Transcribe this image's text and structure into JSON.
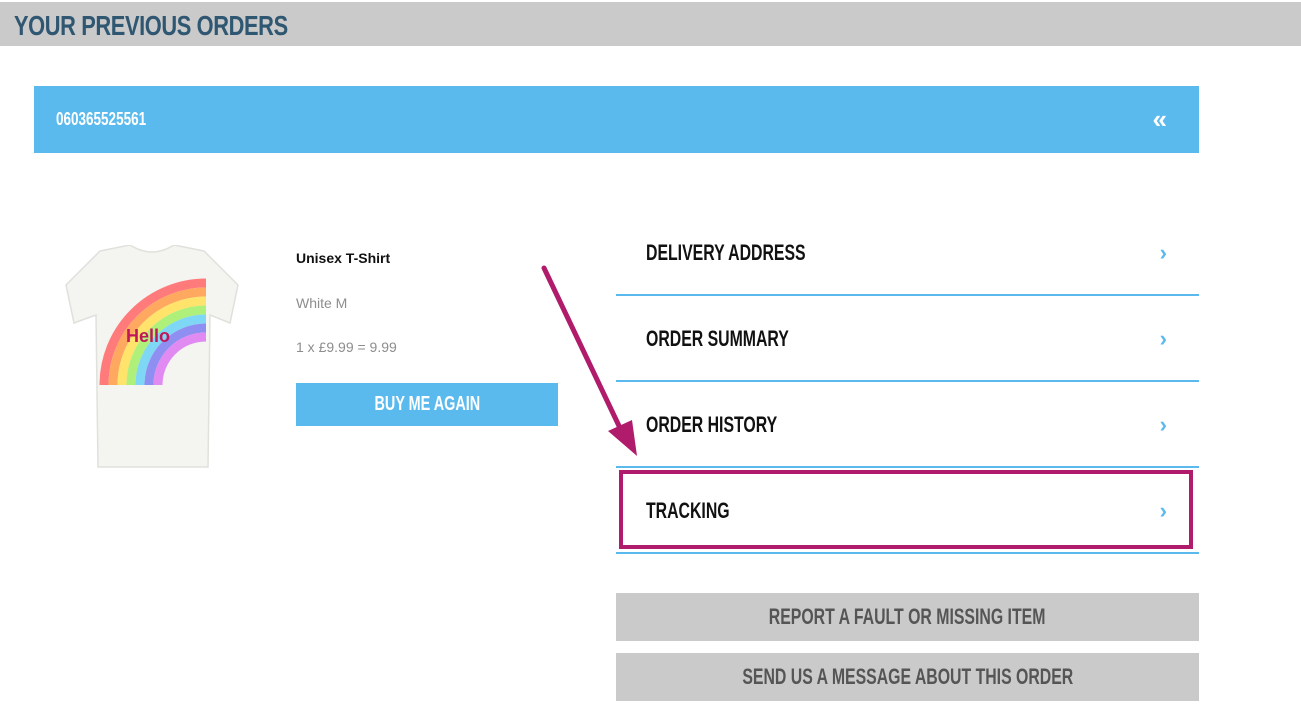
{
  "header": {
    "title": "YOUR PREVIOUS ORDERS"
  },
  "order": {
    "number": "060365525561",
    "collapse_icon": "«"
  },
  "product": {
    "name": "Unisex T-Shirt",
    "variant": "White M",
    "price_line": "1 x £9.99 = 9.99",
    "image_text": "Hello",
    "buy_again_label": "BUY ME AGAIN"
  },
  "menu": {
    "items": [
      {
        "label": "DELIVERY ADDRESS",
        "chevron": "›"
      },
      {
        "label": "ORDER SUMMARY",
        "chevron": "›"
      },
      {
        "label": "ORDER HISTORY",
        "chevron": "›"
      },
      {
        "label": "TRACKING",
        "chevron": "›"
      }
    ]
  },
  "actions": {
    "report_label": "REPORT A FAULT OR MISSING ITEM",
    "message_label": "SEND US A MESSAGE ABOUT THIS ORDER"
  },
  "colors": {
    "header_bg": "#cacaca",
    "header_text": "#2f5772",
    "accent": "#5bbaed",
    "highlight": "#b01c6b"
  }
}
